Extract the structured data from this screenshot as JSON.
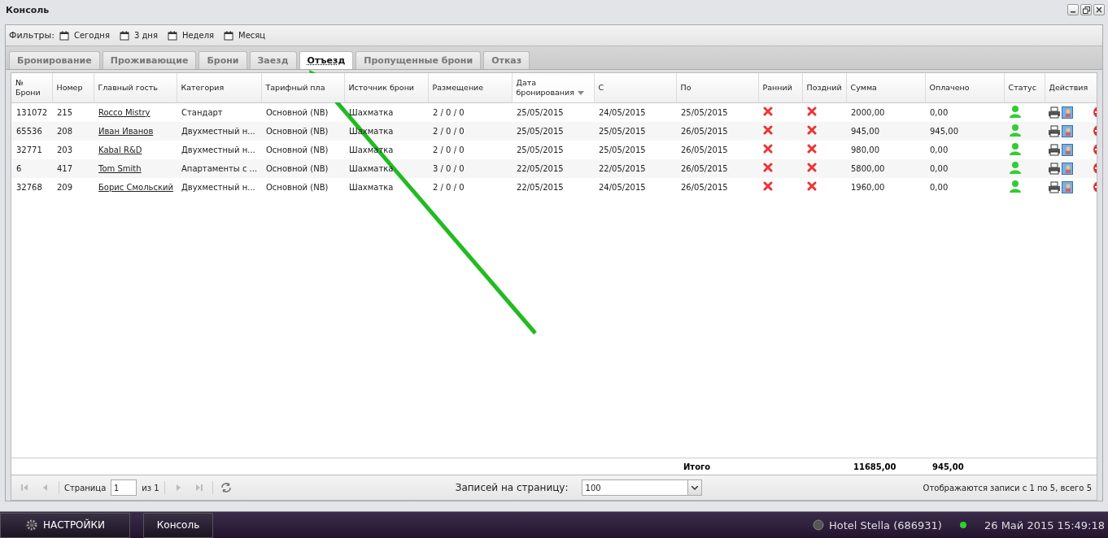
{
  "window": {
    "title": "Консоль"
  },
  "filters": {
    "label": "Фильтры:",
    "items": [
      "Сегодня",
      "3 дня",
      "Неделя",
      "Месяц"
    ]
  },
  "tabs": [
    {
      "label": "Бронирование",
      "selected": false
    },
    {
      "label": "Проживающие",
      "selected": false
    },
    {
      "label": "Брони",
      "selected": false
    },
    {
      "label": "Заезд",
      "selected": false
    },
    {
      "label": "Отъезд",
      "selected": true
    },
    {
      "label": "Пропущенные брони",
      "selected": false
    },
    {
      "label": "Отказ",
      "selected": false
    }
  ],
  "table": {
    "columns": [
      {
        "label": "№ Брони",
        "sorted": false
      },
      {
        "label": "Номер",
        "sorted": false
      },
      {
        "label": "Главный гость",
        "sorted": false
      },
      {
        "label": "Категория",
        "sorted": false
      },
      {
        "label": "Тарифный пла",
        "sorted": false
      },
      {
        "label": "Источник брони",
        "sorted": false
      },
      {
        "label": "Размещение",
        "sorted": false
      },
      {
        "label": "Дата бронирования",
        "sorted": true
      },
      {
        "label": "С",
        "sorted": false
      },
      {
        "label": "По",
        "sorted": false
      },
      {
        "label": "Ранний",
        "sorted": false
      },
      {
        "label": "Поздний",
        "sorted": false
      },
      {
        "label": "Сумма",
        "sorted": false
      },
      {
        "label": "Оплачено",
        "sorted": false
      },
      {
        "label": "Статус",
        "sorted": false
      },
      {
        "label": "Действия",
        "sorted": false
      }
    ],
    "rows": [
      {
        "id": "131072",
        "room": "215",
        "guest": "Rocco Mistry",
        "category": "Стандарт",
        "tariff": "Основной (NB)",
        "source": "Шахматка",
        "placement": "2 / 0 / 0",
        "booked": "25/05/2015",
        "from": "24/05/2015",
        "to": "25/05/2015",
        "early": false,
        "late": false,
        "sum": "2000,00",
        "paid": "0,00"
      },
      {
        "id": "65536",
        "room": "208",
        "guest": "Иван Иванов",
        "category": "Двухместный н...",
        "tariff": "Основной (NB)",
        "source": "Шахматка",
        "placement": "2 / 0 / 0",
        "booked": "25/05/2015",
        "from": "25/05/2015",
        "to": "26/05/2015",
        "early": false,
        "late": false,
        "sum": "945,00",
        "paid": "945,00"
      },
      {
        "id": "32771",
        "room": "203",
        "guest": "Kabal R&D",
        "category": "Двухместный н...",
        "tariff": "Основной (NB)",
        "source": "Шахматка",
        "placement": "2 / 0 / 0",
        "booked": "25/05/2015",
        "from": "25/05/2015",
        "to": "26/05/2015",
        "early": false,
        "late": false,
        "sum": "980,00",
        "paid": "0,00"
      },
      {
        "id": "6",
        "room": "417",
        "guest": "Tom Smith",
        "category": "Апартаменты с ...",
        "tariff": "Основной (NB)",
        "source": "Шахматка",
        "placement": "3 / 0 / 0",
        "booked": "22/05/2015",
        "from": "22/05/2015",
        "to": "26/05/2015",
        "early": false,
        "late": false,
        "sum": "5800,00",
        "paid": "0,00"
      },
      {
        "id": "32768",
        "room": "209",
        "guest": "Борис Смольский",
        "category": "Двухместный н...",
        "tariff": "Основной (NB)",
        "source": "Шахматка",
        "placement": "2 / 0 / 0",
        "booked": "22/05/2015",
        "from": "24/05/2015",
        "to": "26/05/2015",
        "early": false,
        "late": false,
        "sum": "1960,00",
        "paid": "0,00"
      }
    ],
    "totals": {
      "label": "Итого",
      "sum": "11685,00",
      "paid": "945,00"
    }
  },
  "pager": {
    "page_label": "Страница",
    "page": "1",
    "of": "из 1",
    "per_page_label": "Записей на страницу:",
    "per_page": "100",
    "summary": "Отображаются записи с 1 по 5, всего 5"
  },
  "taskbar": {
    "settings": "НАСТРОЙКИ",
    "window": "Консоль",
    "hotel": "Hotel Stella (686931)",
    "datetime": "26 Май 2015 15:49:18"
  }
}
